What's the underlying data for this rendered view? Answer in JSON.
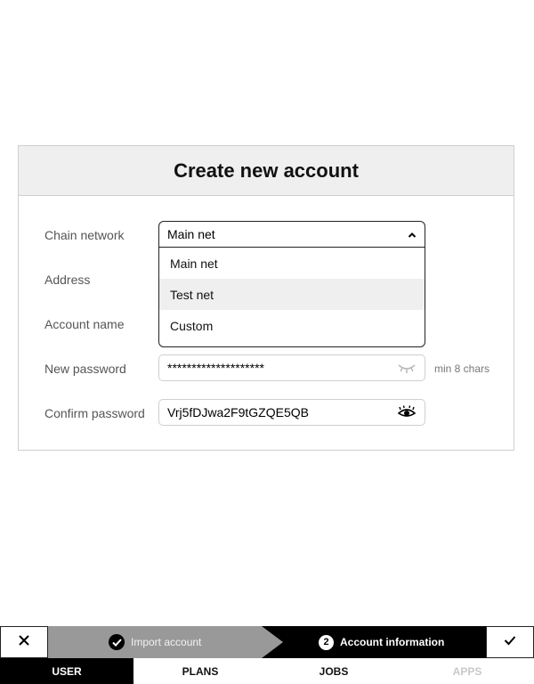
{
  "dialog": {
    "title": "Create new account"
  },
  "form": {
    "chain_network": {
      "label": "Chain network",
      "value": "Main net",
      "options": [
        "Main net",
        "Test net",
        "Custom"
      ],
      "highlighted": "Test net",
      "open": true
    },
    "address": {
      "label": "Address"
    },
    "account_name": {
      "label": "Account name"
    },
    "new_password": {
      "label": "New password",
      "value": "********************",
      "hint": "min 8 chars",
      "visibility_icon": "eye-closed-icon"
    },
    "confirm_password": {
      "label": "Confirm password",
      "value": "Vrj5fDJwa2F9tGZQE5QB",
      "visibility_icon": "eye-open-icon"
    }
  },
  "wizard": {
    "cancel_icon": "close-icon",
    "confirm_icon": "check-icon",
    "steps": [
      {
        "label": "Import account",
        "status": "done"
      },
      {
        "number": "2",
        "label": "Account information",
        "status": "current"
      }
    ]
  },
  "tabs": [
    {
      "label": "USER",
      "active": true
    },
    {
      "label": "PLANS",
      "active": false
    },
    {
      "label": "JOBS",
      "active": false
    },
    {
      "label": "APPS",
      "disabled": true
    }
  ],
  "colors": {
    "dark": "#000000",
    "step_done": "#999999",
    "option_hover": "#efefef",
    "header_bg": "#efefef"
  }
}
